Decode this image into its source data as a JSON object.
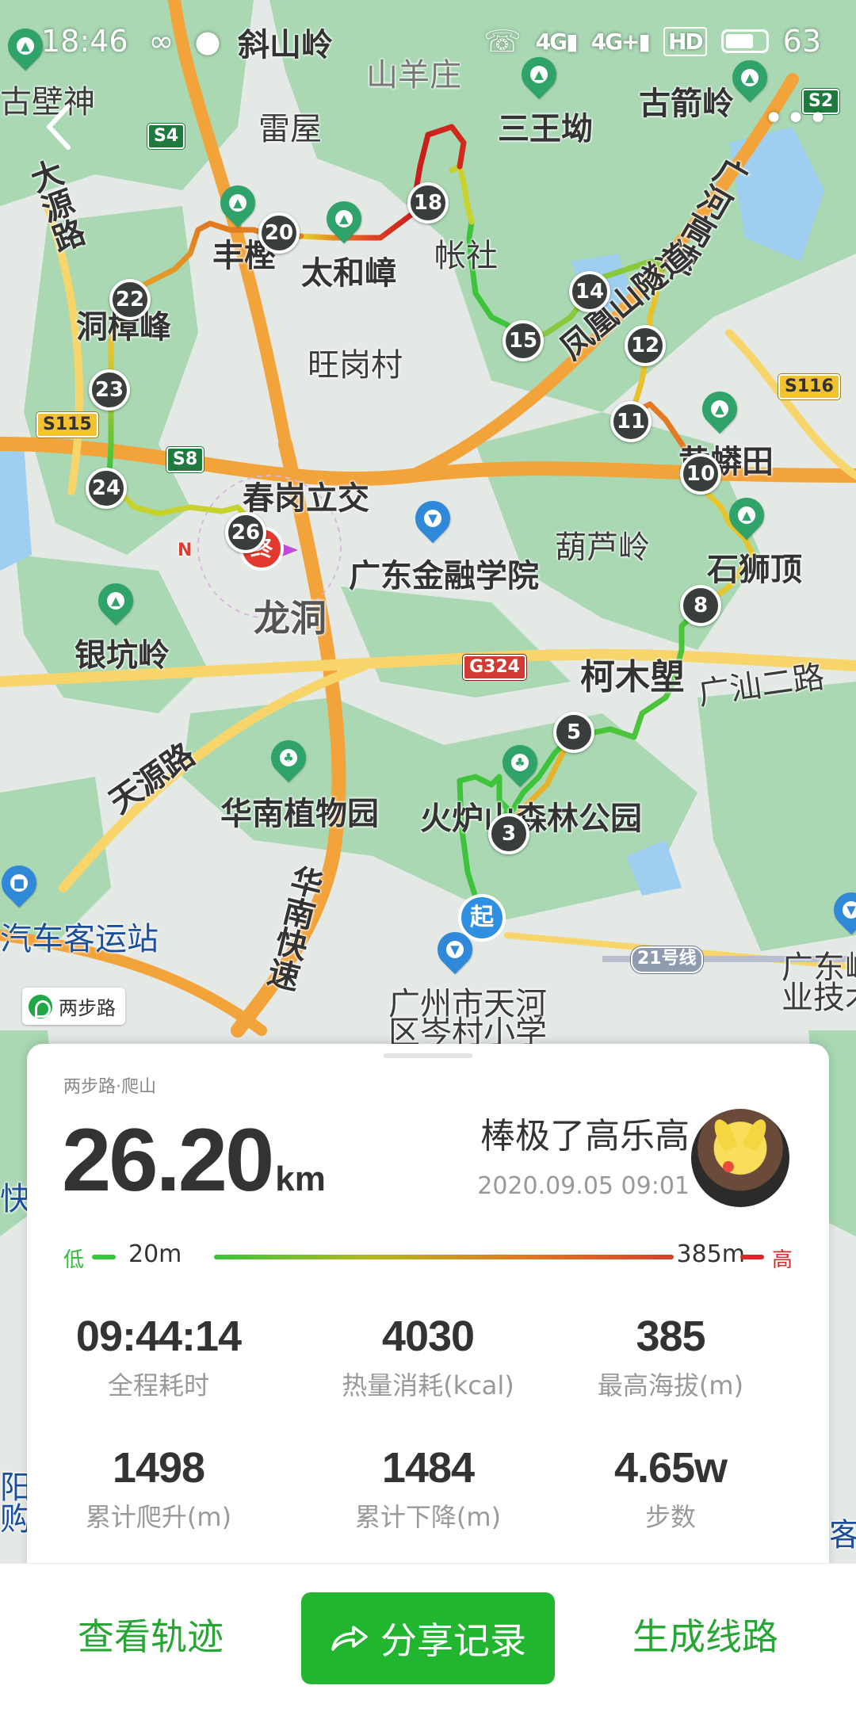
{
  "status_bar": {
    "time": "18:46",
    "net1": "4G",
    "net2": "4G+",
    "hd": "HD",
    "battery": "63"
  },
  "map": {
    "labels": {
      "xieshanling": "斜山岭",
      "shanyangzhuang": "山羊庄",
      "guangbishen": "古壁神",
      "leiwu": "雷屋",
      "sanwangao": "三王坳",
      "gujianling": "古箭岭",
      "dayuanlu": "大源路",
      "fengwei": "丰樫",
      "taihezhang": "太和嶂",
      "zhangshi": "帐社",
      "guanghegaosu": "广河高速",
      "dongzhangfeng": "洞樟峰",
      "wanggangcun": "旺岗村",
      "fenghuangshan": "凤凰山隧道",
      "huangmangtian": "黄蟒田",
      "chungangjiaojiao": "春岗立交",
      "hulu": "葫芦岭",
      "shishiding": "石狮顶",
      "gdjr": "广东金融学院",
      "longdong": "龙洞",
      "yinkengling": "银坑岭",
      "kemulang": "柯木塱",
      "guangshan2": "广汕二路",
      "tianyuanlu": "天源路",
      "huananzhiwuyuan": "华南植物园",
      "huoluoshan": "火炉山森林公园",
      "huanankuaisu": "华南快速",
      "qichekeyunzhan": "汽车客运站",
      "line21": "21号线",
      "gdling": "广东岭",
      "yejiShu": "业技术",
      "cenxiao": "广州市天河",
      "cenxiao2": "区岑村小学",
      "kuai": "快",
      "yang": "阳",
      "gou": "购",
      "ke": "客"
    },
    "shields": {
      "s4": "S4",
      "s2": "S2",
      "s115": "S115",
      "s8": "S8",
      "s116": "S116",
      "g324": "G324"
    },
    "markers": {
      "start": "起",
      "end": "终",
      "km3": "3",
      "km5": "5",
      "km8": "8",
      "km10": "10",
      "km11": "11",
      "km12": "12",
      "km14": "14",
      "km15": "15",
      "km18": "18",
      "km20": "20",
      "km22": "22",
      "km23": "23",
      "km24": "24",
      "km26": "26"
    },
    "compass_n": "N",
    "brand": "两步路"
  },
  "nav": {
    "more": "•••"
  },
  "card": {
    "activity_type": "两步路·爬山",
    "distance_value": "26.20",
    "distance_unit": "km",
    "user_name": "棒极了高乐高",
    "date": "2020.09.05 09:01",
    "elevation": {
      "low_label": "低",
      "min": "20m",
      "max": "385m",
      "high_label": "高"
    },
    "stats": [
      {
        "value": "09:44:14",
        "label": "全程耗时"
      },
      {
        "value": "4030",
        "label": "热量消耗(kcal)"
      },
      {
        "value": "385",
        "label": "最高海拔(m)"
      },
      {
        "value": "1498",
        "label": "累计爬升(m)"
      },
      {
        "value": "1484",
        "label": "累计下降(m)"
      },
      {
        "value": "4.65w",
        "label": "步数"
      }
    ]
  },
  "actions": {
    "view_track": "查看轨迹",
    "share": "分享记录",
    "gen_route": "生成线路"
  },
  "colors": {
    "brand_green": "#22b530",
    "track_low": "#3ac43a",
    "track_high": "#d5402a"
  }
}
